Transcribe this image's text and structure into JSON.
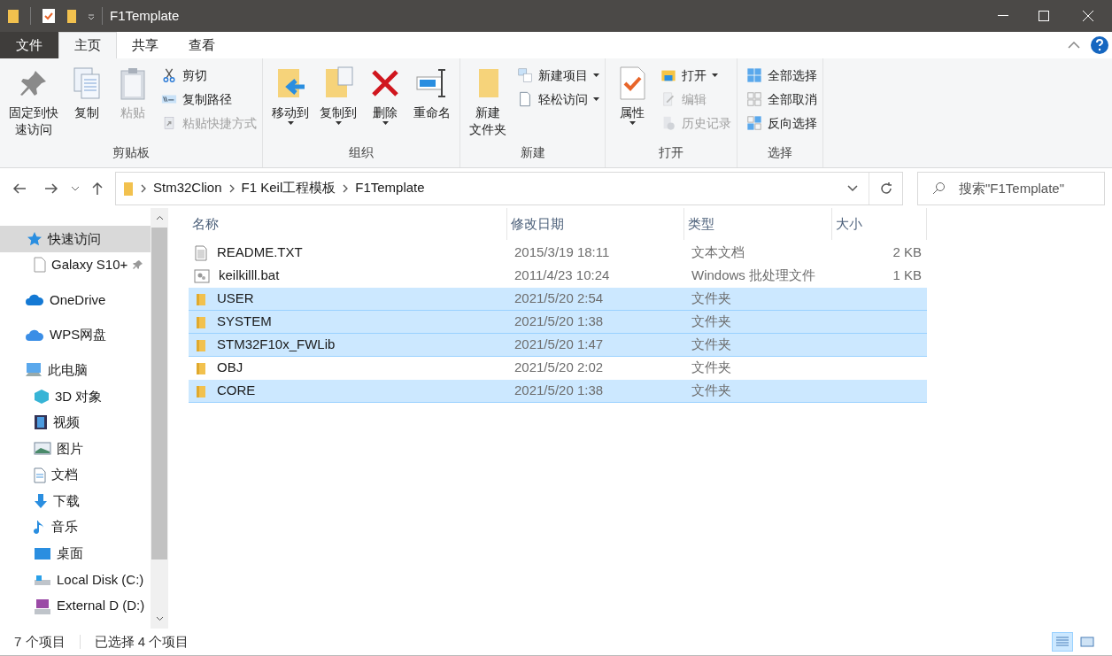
{
  "window": {
    "title": "F1Template"
  },
  "tabs": [
    {
      "label": "文件",
      "kind": "file",
      "selected": false
    },
    {
      "label": "主页",
      "kind": "tab",
      "selected": true
    },
    {
      "label": "共享",
      "kind": "tab",
      "selected": false
    },
    {
      "label": "查看",
      "kind": "tab",
      "selected": false
    }
  ],
  "ribbon": [
    {
      "label": "剪贴板",
      "items": [
        {
          "lines": [
            "固定到快",
            "速访问"
          ],
          "kind": "large",
          "disabled": false,
          "menu": false
        },
        {
          "label": "复制",
          "kind": "large",
          "disabled": false,
          "menu": false
        },
        {
          "label": "粘贴",
          "kind": "large",
          "disabled": true,
          "menu": false
        },
        {
          "label": "剪切",
          "kind": "small",
          "disabled": false,
          "menu": false
        },
        {
          "label": "复制路径",
          "kind": "small",
          "disabled": false,
          "menu": false
        },
        {
          "label": "粘贴快捷方式",
          "kind": "small",
          "disabled": true,
          "menu": false
        }
      ]
    },
    {
      "label": "组织",
      "items": [
        {
          "label": "移动到",
          "kind": "large",
          "disabled": false,
          "menu": true
        },
        {
          "label": "复制到",
          "kind": "large",
          "disabled": false,
          "menu": true
        },
        {
          "label": "删除",
          "kind": "large",
          "disabled": false,
          "menu": true
        },
        {
          "label": "重命名",
          "kind": "large",
          "disabled": false,
          "menu": false
        }
      ]
    },
    {
      "label": "新建",
      "items": [
        {
          "lines": [
            "新建",
            "文件夹"
          ],
          "kind": "large",
          "disabled": false,
          "menu": false
        },
        {
          "label": "新建项目",
          "kind": "small",
          "disabled": false,
          "menu": true
        },
        {
          "label": "轻松访问",
          "kind": "small",
          "disabled": false,
          "menu": true
        }
      ]
    },
    {
      "label": "打开",
      "items": [
        {
          "label": "属性",
          "kind": "large",
          "disabled": false,
          "menu": true
        },
        {
          "label": "打开",
          "kind": "small",
          "disabled": false,
          "menu": true
        },
        {
          "label": "编辑",
          "kind": "small",
          "disabled": true,
          "menu": false
        },
        {
          "label": "历史记录",
          "kind": "small",
          "disabled": true,
          "menu": false
        }
      ]
    },
    {
      "label": "选择",
      "items": [
        {
          "label": "全部选择",
          "kind": "small",
          "disabled": false,
          "menu": false
        },
        {
          "label": "全部取消",
          "kind": "small",
          "disabled": false,
          "menu": false
        },
        {
          "label": "反向选择",
          "kind": "small",
          "disabled": false,
          "menu": false
        }
      ]
    }
  ],
  "address": {
    "path": [
      "Stm32Clion",
      "F1 Keil工程模板",
      "F1Template"
    ],
    "search_placeholder": "搜索\"F1Template\""
  },
  "sidebar": [
    {
      "label": "快速访问",
      "selected": true,
      "children": [
        {
          "label": "Galaxy S10+",
          "selected": false,
          "pinned": true
        }
      ]
    },
    {
      "label": "OneDrive",
      "selected": false
    },
    {
      "label": "WPS网盘",
      "selected": false
    },
    {
      "label": "此电脑",
      "selected": false,
      "children": [
        {
          "label": "3D 对象",
          "selected": false
        },
        {
          "label": "视频",
          "selected": false
        },
        {
          "label": "图片",
          "selected": false
        },
        {
          "label": "文档",
          "selected": false
        },
        {
          "label": "下载",
          "selected": false
        },
        {
          "label": "音乐",
          "selected": false
        },
        {
          "label": "桌面",
          "selected": false
        },
        {
          "label": "Local Disk (C:)",
          "selected": false
        },
        {
          "label": "External D (D:)",
          "selected": false
        }
      ]
    }
  ],
  "table": {
    "columns": [
      "名称",
      "修改日期",
      "类型",
      "大小"
    ],
    "rows": [
      {
        "name": "README.TXT",
        "kind": "text",
        "modified": "2015/3/19 18:11",
        "type": "文本文档",
        "size": "2 KB",
        "selected": false
      },
      {
        "name": "keilkilll.bat",
        "kind": "batch",
        "modified": "2011/4/23 10:24",
        "type": "Windows 批处理文件",
        "size": "1 KB",
        "selected": false
      },
      {
        "name": "USER",
        "kind": "folder",
        "modified": "2021/5/20 2:54",
        "type": "文件夹",
        "selected": true
      },
      {
        "name": "SYSTEM",
        "kind": "folder",
        "modified": "2021/5/20 1:38",
        "type": "文件夹",
        "selected": true
      },
      {
        "name": "STM32F10x_FWLib",
        "kind": "folder",
        "modified": "2021/5/20 1:47",
        "type": "文件夹",
        "selected": true
      },
      {
        "name": "OBJ",
        "kind": "folder",
        "modified": "2021/5/20 2:02",
        "type": "文件夹",
        "selected": false
      },
      {
        "name": "CORE",
        "kind": "folder",
        "modified": "2021/5/20 1:38",
        "type": "文件夹",
        "selected": true
      }
    ]
  },
  "status_bar": {
    "count": "7 个项目",
    "selection": "已选择 4 个项目",
    "views": [
      {
        "kind": "details",
        "selected": true
      },
      {
        "kind": "icons",
        "selected": false
      }
    ]
  }
}
